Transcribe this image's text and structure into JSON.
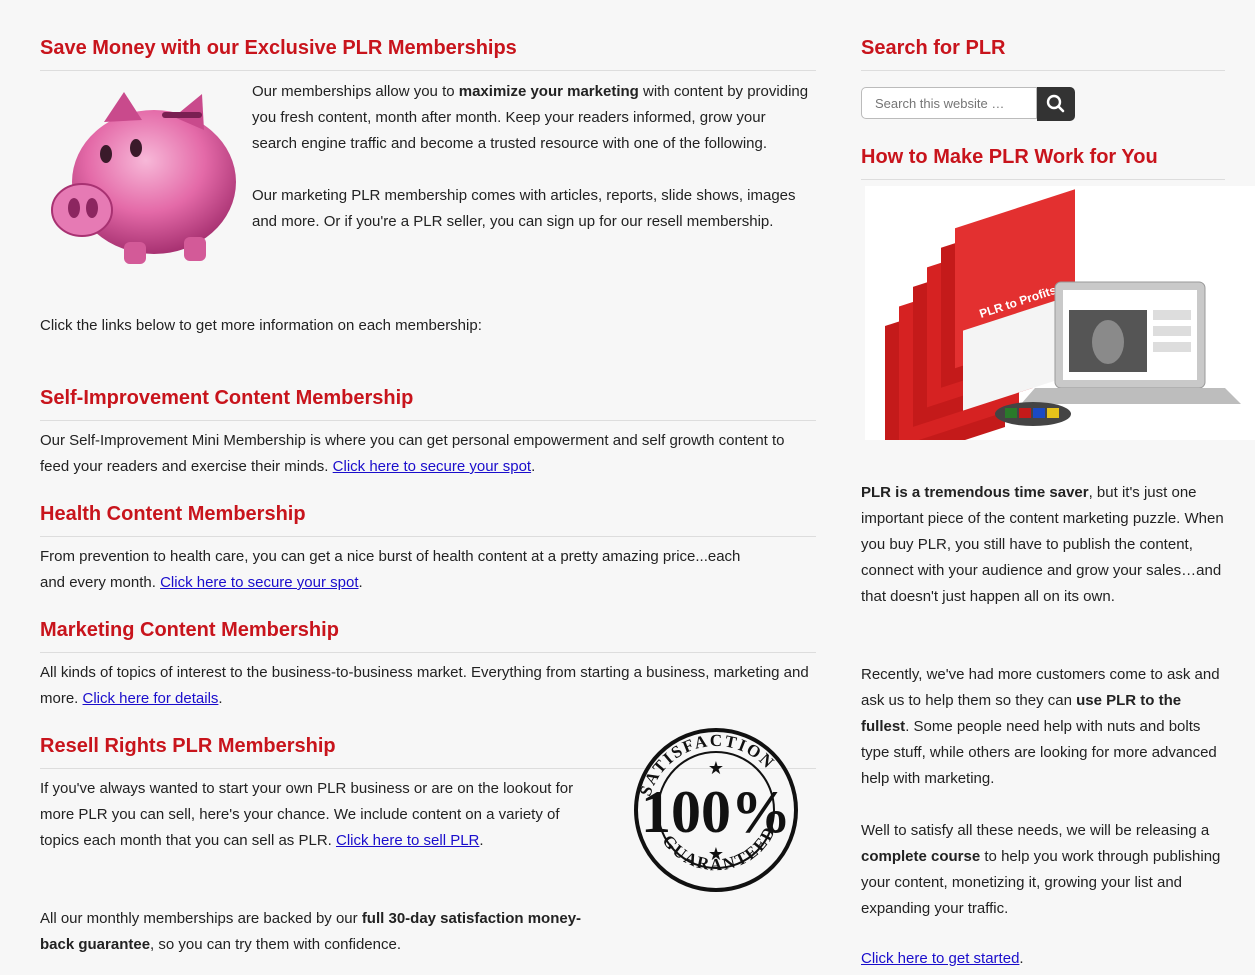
{
  "main": {
    "title": "Save Money with our Exclusive PLR Memberships",
    "intro_p1_a": "Our memberships allow you to ",
    "intro_p1_b": "maximize your marketing",
    "intro_p1_c": " with content by providing you fresh content, month after month. Keep your readers informed, grow your search engine traffic and become a trusted resource with one of the following.",
    "intro_p2": "Our marketing PLR membership comes with articles, reports, slide shows, images and more. Or if you're a PLR seller, you can sign up for our resell membership.",
    "click_links": "Click the links below to get more information on each membership:",
    "self_title": "Self-Improvement Content Membership",
    "self_text": "Our Self-Improvement Mini Membership is where you can get personal empowerment and self growth content to feed your readers and exercise their minds. ",
    "self_link": "Click here to secure your spot",
    "health_title": "Health Content Membership",
    "health_text": "From prevention to health care, you can get a nice burst of health content at a pretty amazing price...each and every month. ",
    "health_link": "Click here to secure your spot",
    "marketing_title": "Marketing Content Membership",
    "marketing_text": "All kinds of topics of interest to the business-to-business market. Everything from starting a business, marketing and more. ",
    "marketing_link": "Click here for details",
    "resell_title": "Resell Rights PLR Membership",
    "resell_text": "If you've always wanted to start your own PLR business or are on the lookout for more PLR you can sell, here's your chance. We include content on a variety of topics each month that you can sell as PLR. ",
    "resell_link": "Click here to sell PLR",
    "guarantee_a": "All our monthly memberships are backed by our ",
    "guarantee_b": "full 30-day satisfaction money-back guarantee",
    "guarantee_c": ", so you can try them with confidence.",
    "stamp_top": "SATISFACTION",
    "stamp_big": "100%",
    "stamp_bottom": "GUARANTEED"
  },
  "sidebar": {
    "search_title": "Search for PLR",
    "search_placeholder": "Search this website …",
    "howto_title": "How to Make PLR Work for You",
    "product_label": "PLR to Profits",
    "p1_b": "PLR is a tremendous time saver",
    "p1_rest": ", but it's just one important piece of the content marketing puzzle. When you buy PLR, you still have to publish the content, connect with your audience and grow your sales…and that doesn't just happen all on its own.",
    "p2_a": "Recently, we've had more customers come to ask and ask us to help them so they can ",
    "p2_b": "use PLR to the fullest",
    "p2_c": ". Some people need help with nuts and bolts type stuff, while others are looking for more advanced help with marketing.",
    "p3_a": "Well to satisfy all these needs, we will be releasing a ",
    "p3_b": "complete course",
    "p3_c": " to help you work through publishing your content, monetizing it, growing your list and expanding your traffic.",
    "cta_link": "Click here to get started",
    "cta_period": "."
  },
  "colors": {
    "heading": "#c8141c",
    "link": "#1a0dcc"
  }
}
